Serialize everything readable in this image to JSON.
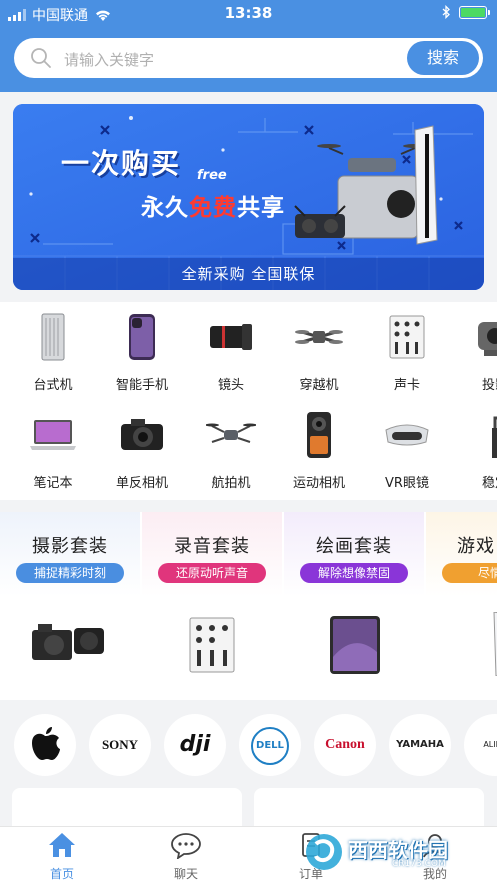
{
  "status_bar": {
    "carrier": "中国联通",
    "time": "13:38"
  },
  "search": {
    "placeholder": "请输入关键字",
    "button_label": "搜索"
  },
  "banner": {
    "line1": "一次购买",
    "free_text": "free",
    "line2_prefix": "永久",
    "line2_highlight": "免费",
    "line2_suffix": "共享",
    "footer": "全新采购 全国联保"
  },
  "categories": [
    {
      "label": "台式机",
      "icon": "desktop-tower-icon"
    },
    {
      "label": "智能手机",
      "icon": "smartphone-icon"
    },
    {
      "label": "镜头",
      "icon": "camera-lens-icon"
    },
    {
      "label": "穿越机",
      "icon": "fpv-drone-icon"
    },
    {
      "label": "声卡",
      "icon": "audio-mixer-icon"
    },
    {
      "label": "投影",
      "icon": "projector-icon"
    },
    {
      "label": "笔记本",
      "icon": "laptop-icon"
    },
    {
      "label": "单反相机",
      "icon": "dslr-camera-icon"
    },
    {
      "label": "航拍机",
      "icon": "aerial-drone-icon"
    },
    {
      "label": "运动相机",
      "icon": "action-camera-icon"
    },
    {
      "label": "VR眼镜",
      "icon": "vr-headset-icon"
    },
    {
      "label": "稳定",
      "icon": "gimbal-stabilizer-icon"
    }
  ],
  "sets": [
    {
      "title": "摄影套装",
      "tag": "捕捉精彩时刻",
      "tag_color": "#4a8ee0",
      "bg": "#eef3fb"
    },
    {
      "title": "录音套装",
      "tag": "还原动听声音",
      "tag_color": "#e0357c",
      "bg": "#fcedf3"
    },
    {
      "title": "绘画套装",
      "tag": "解除想像禁固",
      "tag_color": "#8a35d8",
      "bg": "#f3ecfb"
    },
    {
      "title": "游戏",
      "tag": "尽情释",
      "tag_color": "#f0a030",
      "bg": "#fdf5e6"
    }
  ],
  "brands": [
    {
      "name": "Apple",
      "text": ""
    },
    {
      "name": "Sony",
      "text": "SONY"
    },
    {
      "name": "DJI",
      "text": "dji"
    },
    {
      "name": "Dell",
      "text": "DELL"
    },
    {
      "name": "Canon",
      "text": "Canon"
    },
    {
      "name": "Yamaha",
      "text": "YAMAHA"
    },
    {
      "name": "Alienware",
      "text": "ALIEN"
    }
  ],
  "tabs": [
    {
      "label": "首页",
      "icon": "home-icon",
      "active": true
    },
    {
      "label": "聊天",
      "icon": "chat-bubble-icon",
      "active": false
    },
    {
      "label": "订单",
      "icon": "order-icon",
      "active": false
    },
    {
      "label": "我的",
      "icon": "profile-icon",
      "active": false
    }
  ],
  "watermark": {
    "text": "西西软件园",
    "sub": "CR173.COM"
  },
  "colors": {
    "primary": "#4a90e2",
    "banner_bg": "#2f6fe8",
    "highlight_red": "#ff3a30"
  }
}
